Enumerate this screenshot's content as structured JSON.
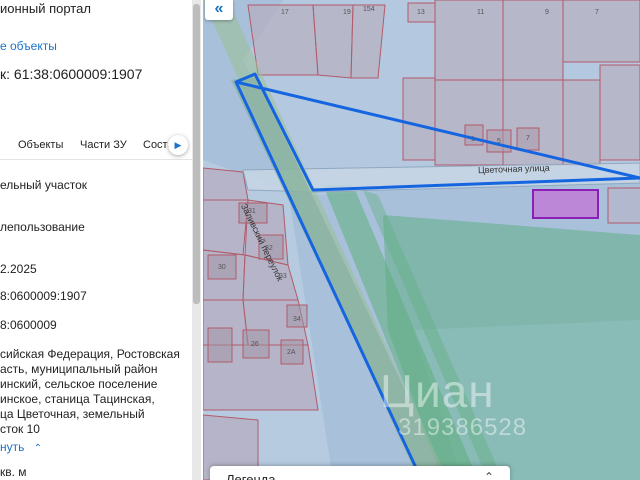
{
  "panel": {
    "portal_title": "ионный портал",
    "show_objects_link": "е объекты",
    "cadastral_number": "к: 61:38:0600009:1907",
    "tabs": [
      "Объекты",
      "Части ЗУ",
      "Соста"
    ],
    "tab_more_icon": "chevron-right-icon",
    "rows": [
      "ельный участок",
      "лепользование",
      "2.2025",
      "8:0600009:1907",
      "8:0600009",
      "сийская Федерация, Ростовская",
      "асть, муниципальный район",
      "инский, сельское поселение",
      "инское, станица Тацинская,",
      "ца Цветочная, земельный",
      "сток 10"
    ],
    "collapse_link": "нуть",
    "area_unit": "кв. м"
  },
  "map": {
    "collapse_button": "«",
    "street_label_vertical": "Заливский переулок",
    "street_label_horizontal": "Цветочная улица",
    "parcel_numbers": [
      "17",
      "19",
      "154",
      "13",
      "11",
      "9",
      "7",
      "1",
      "5",
      "7",
      "31",
      "32",
      "30",
      "33",
      "34",
      "26",
      "2А"
    ],
    "watermark_brand": "Циан",
    "watermark_id": "319386528",
    "legend_title": "Легенда",
    "legend_icon": "chevron-up-icon"
  },
  "colors": {
    "link": "#1a73c9",
    "selection": "#1565e0",
    "highlight_fill": "#c278d6",
    "highlight_stroke": "#8a1fb5",
    "map_base": "#a8c0da",
    "green_zone": "#6fb59a"
  }
}
